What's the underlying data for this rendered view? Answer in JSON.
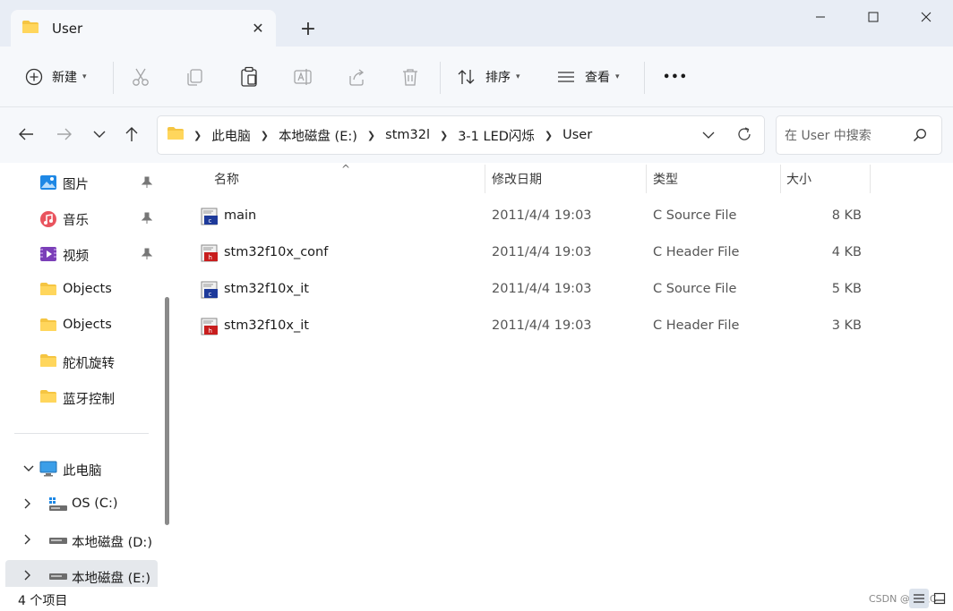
{
  "window": {
    "tab_title": "User",
    "new_tab_symbol": "+",
    "close_tab_symbol": "✕"
  },
  "toolbar": {
    "new_label": "新建",
    "sort_label": "排序",
    "view_label": "查看",
    "more_symbol": "•••"
  },
  "breadcrumb": [
    "此电脑",
    "本地磁盘 (E:)",
    "stm32l",
    "3-1 LED闪烁",
    "User"
  ],
  "search": {
    "placeholder": "在 User 中搜索"
  },
  "sidebar": {
    "quick_access": [
      {
        "label": "图片",
        "icon": "pictures-icon",
        "pinned": true
      },
      {
        "label": "音乐",
        "icon": "music-icon",
        "pinned": true
      },
      {
        "label": "视频",
        "icon": "videos-icon",
        "pinned": true
      },
      {
        "label": "Objects",
        "icon": "folder-icon",
        "pinned": false
      },
      {
        "label": "Objects",
        "icon": "folder-icon",
        "pinned": false
      },
      {
        "label": "舵机旋转",
        "icon": "folder-icon",
        "pinned": false
      },
      {
        "label": "蓝牙控制",
        "icon": "folder-icon",
        "pinned": false
      }
    ],
    "this_pc": {
      "label": "此电脑",
      "icon": "monitor-icon"
    },
    "drives": [
      {
        "label": "OS (C:)",
        "icon": "os-drive-icon"
      },
      {
        "label": "本地磁盘 (D:)",
        "icon": "drive-icon"
      },
      {
        "label": "本地磁盘 (E:)",
        "icon": "drive-icon"
      }
    ]
  },
  "columns": {
    "name": "名称",
    "date": "修改日期",
    "type": "类型",
    "size": "大小"
  },
  "files": [
    {
      "name": "main",
      "date": "2011/4/4 19:03",
      "type": "C Source File",
      "size": "8 KB",
      "kind": "c-source"
    },
    {
      "name": "stm32f10x_conf",
      "date": "2011/4/4 19:03",
      "type": "C Header File",
      "size": "4 KB",
      "kind": "c-header"
    },
    {
      "name": "stm32f10x_it",
      "date": "2011/4/4 19:03",
      "type": "C Source File",
      "size": "5 KB",
      "kind": "c-source"
    },
    {
      "name": "stm32f10x_it",
      "date": "2011/4/4 19:03",
      "type": "C Header File",
      "size": "3 KB",
      "kind": "c-header"
    }
  ],
  "status": {
    "item_count": "4 个项目",
    "watermark": "CSDN @秋沨C"
  },
  "colors": {
    "accent_folder": "#f5c542",
    "c_source_badge": "#1e3a9a",
    "c_header_badge": "#c81e1e",
    "selected_row": "#e5e8ec"
  }
}
